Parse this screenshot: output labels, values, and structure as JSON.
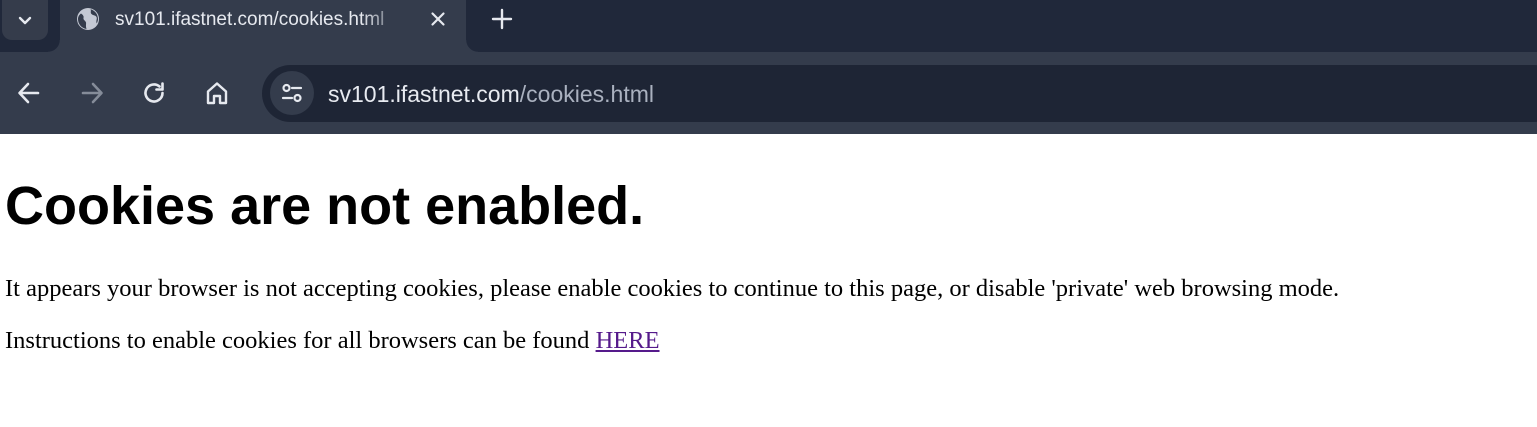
{
  "browser": {
    "tab": {
      "title": "sv101.ifastnet.com/cookies.html",
      "favicon": "globe-icon"
    },
    "omnibox": {
      "url_host": "sv101.ifastnet.com",
      "url_path": "/cookies.html",
      "site_info_icon": "tune-icon"
    },
    "icons": {
      "tab_search": "chevron-down-icon",
      "tab_close": "close-icon",
      "new_tab": "plus-icon",
      "back": "arrow-left-icon",
      "forward": "arrow-right-icon",
      "reload": "reload-icon",
      "home": "home-icon"
    },
    "colors": {
      "frame": "#20283a",
      "toolbar": "#343c4c",
      "omnibox": "#1e2535"
    }
  },
  "page": {
    "title": "Cookies are not enabled.",
    "paragraph1": "It appears your browser is not accepting cookies, please enable cookies to continue to this page, or disable 'private' web browsing mode.",
    "paragraph2_text": "Instructions to enable cookies for all browsers can be found ",
    "link_label": "HERE",
    "colors": {
      "link": "#551a8b"
    }
  }
}
